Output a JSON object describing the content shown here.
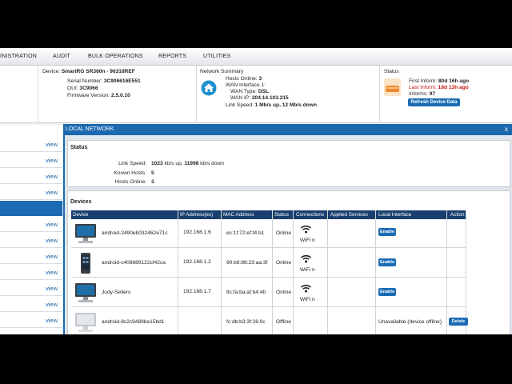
{
  "nav": {
    "items": [
      "INISTRATION",
      "AUDIT",
      "BULK OPERATIONS",
      "REPORTS",
      "UTILITIES"
    ]
  },
  "device": {
    "name_label": "Device:",
    "name": "SmartRG SR360n - 96318REF",
    "serial_label": "Serial Number:",
    "serial": "3C906616E551",
    "oui_label": "OUI:",
    "oui": "3C9066",
    "firmware_label": "Firmware Version:",
    "firmware": "2.5.0.10"
  },
  "network_summary": {
    "title": "Network Summary",
    "hosts_online_label": "Hosts Online:",
    "hosts_online": "3",
    "wan_interface": "WAN Interface 1:",
    "wan_type_label": "WAN Type:",
    "wan_type": "DSL",
    "wan_ip_label": "WAN IP:",
    "wan_ip": "204.14.103.215",
    "link_speed_label": "Link Speed:",
    "link_speed": "1 Mb/s up, 12 Mb/s down"
  },
  "status_box": {
    "title": "Status",
    "first_inform_label": "First Inform:",
    "first_inform": "80d 16h ago",
    "last_inform_label": "Last Inform:",
    "last_inform": "18d 13h ago",
    "informs_label": "Informs:",
    "informs": "97",
    "refresh_button": "Refresh Device Data"
  },
  "left_list": {
    "view_label": "view"
  },
  "modal": {
    "title": "LOCAL NETWORK",
    "close": "x",
    "status": {
      "title": "Status",
      "link_speed_label": "Link Speed:",
      "link_speed_up": "1023",
      "link_speed_mid": " kb/s up, ",
      "link_speed_down": "11998",
      "link_speed_tail": " kb/s down",
      "known_hosts_label": "Known Hosts:",
      "known_hosts": "5",
      "hosts_online_label": "Hosts Online:",
      "hosts_online": "3"
    },
    "devices": {
      "title": "Devices",
      "columns": [
        "Device",
        "IP Address(es)",
        "MAC Address",
        "Status",
        "Connections",
        "Applied Services",
        "Local Interface",
        "Action"
      ],
      "rows": [
        {
          "name": "android-2490eb032462e71c",
          "ip": "192.168.1.6",
          "mac": "ec:1f:72:ef:f4:b1",
          "status": "Online",
          "connection": "WiFi n",
          "local_interface": "Enable",
          "action": "",
          "icon": "desktop-computer-icon"
        },
        {
          "name": "android-c408689122cf42ca",
          "ip": "192.168.1.2",
          "mac": "90:b6:86:23:aa:3f",
          "status": "Online",
          "connection": "WiFi n",
          "local_interface": "Enable",
          "action": "",
          "icon": "smartphone-icon"
        },
        {
          "name": "Judy-Sellers",
          "ip": "192.168.1.7",
          "mac": "8c:fa:ba:af:b4:4b",
          "status": "Online",
          "connection": "WiFi n",
          "local_interface": "Enable",
          "action": "",
          "icon": "desktop-computer-icon"
        },
        {
          "name": "android-8c2c9489be15bd1",
          "ip": "",
          "mac": "fc:db:b3:3f:26:9c",
          "status": "Offline",
          "connection": "",
          "local_interface": "Unavailable (device offline)",
          "action": "Delete",
          "icon": "desktop-computer-offline-icon"
        }
      ]
    }
  }
}
